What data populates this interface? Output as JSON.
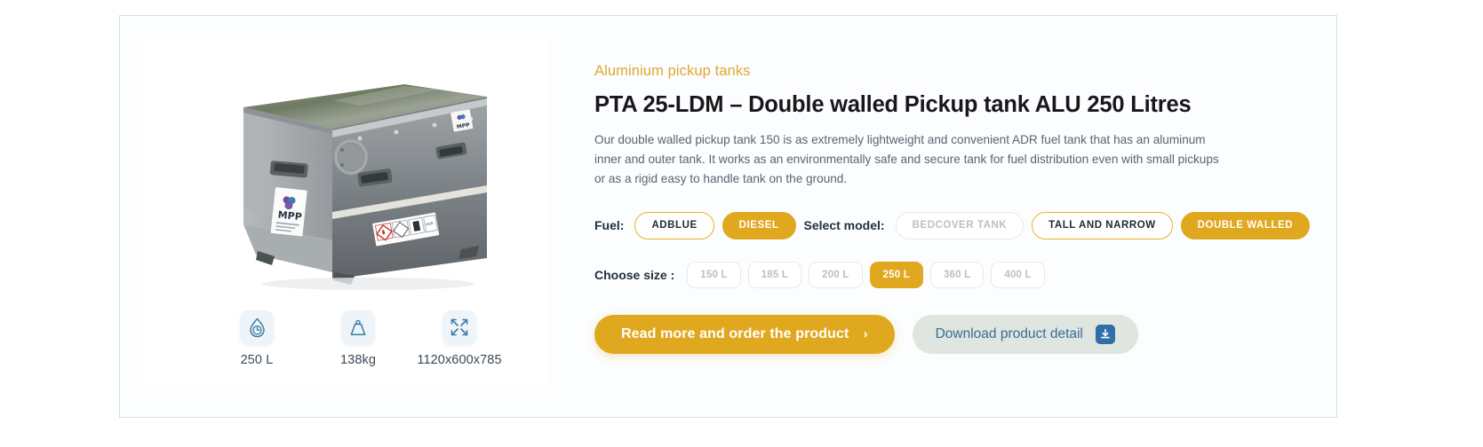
{
  "product": {
    "category": "Aluminium pickup tanks",
    "title": "PTA 25-LDM – Double walled Pickup tank ALU 250 Litres",
    "description": "Our double walled pickup tank 150 is as extremely lightweight and convenient ADR fuel tank that has an aluminum inner and outer tank. It works as an environmentally safe and secure tank for fuel distribution even with small pickups or as a rigid easy to handle tank on the ground.",
    "image_alt": "Aluminium double walled pickup tank with MPP labels and ADR hazard placards"
  },
  "specs": [
    {
      "icon": "volume-droplet-icon",
      "value": "250 L"
    },
    {
      "icon": "weight-icon",
      "value": "138kg"
    },
    {
      "icon": "dimensions-icon",
      "value": "1120x600x785"
    }
  ],
  "options": {
    "fuel": {
      "label": "Fuel:",
      "items": [
        {
          "label": "ADBLUE",
          "state": "available"
        },
        {
          "label": "DIESEL",
          "state": "selected"
        }
      ]
    },
    "model": {
      "label": "Select model:",
      "items": [
        {
          "label": "BEDCOVER TANK",
          "state": "disabled"
        },
        {
          "label": "TALL AND NARROW",
          "state": "available"
        },
        {
          "label": "DOUBLE WALLED",
          "state": "selected"
        }
      ]
    },
    "size": {
      "label": "Choose size :",
      "items": [
        {
          "label": "150 L",
          "state": "disabled"
        },
        {
          "label": "185 L",
          "state": "disabled"
        },
        {
          "label": "200 L",
          "state": "disabled"
        },
        {
          "label": "250 L",
          "state": "selected"
        },
        {
          "label": "360 L",
          "state": "disabled"
        },
        {
          "label": "400 L",
          "state": "disabled"
        }
      ]
    }
  },
  "actions": {
    "primary": {
      "label": "Read more and order the product",
      "chevron": "›"
    },
    "secondary": {
      "label": "Download product detail",
      "icon": "download-icon"
    }
  },
  "colors": {
    "accent": "#e0a81e",
    "eyebrow": "#e0a82e",
    "title": "#18181a",
    "body_text": "#5a6470",
    "card_border": "#cfe0e8",
    "secondary_btn_bg": "#dfe6e0",
    "secondary_btn_text": "#3a6c96",
    "icon_blue": "#3a7ca5"
  }
}
